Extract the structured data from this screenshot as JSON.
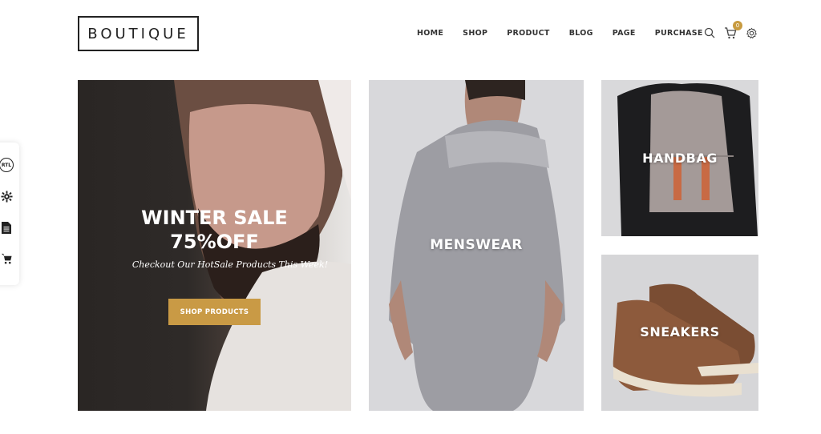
{
  "brand": {
    "logo": "BOUTIQUE"
  },
  "nav": {
    "items": [
      "HOME",
      "SHOP",
      "PRODUCT",
      "BLOG",
      "PAGE",
      "PURCHASE"
    ]
  },
  "header": {
    "cart_count": "0",
    "icons": [
      "search-icon",
      "cart-icon",
      "settings-icon"
    ]
  },
  "side_toolbar": {
    "rtl_label": "RTL",
    "icons": [
      "rtl-icon",
      "gear-icon",
      "document-icon",
      "cart-icon"
    ]
  },
  "hero": {
    "title_line1": "WINTER SALE",
    "title_line2": "75%OFF",
    "subtitle": "Checkout Our HotSale Products This Week!",
    "button_label": "SHOP PRODUCTS"
  },
  "categories": {
    "menswear": "MENSWEAR",
    "handbag": "HANDBAG",
    "sneakers": "SNEAKERS"
  },
  "colors": {
    "accent": "#c99a45",
    "text": "#222222"
  }
}
